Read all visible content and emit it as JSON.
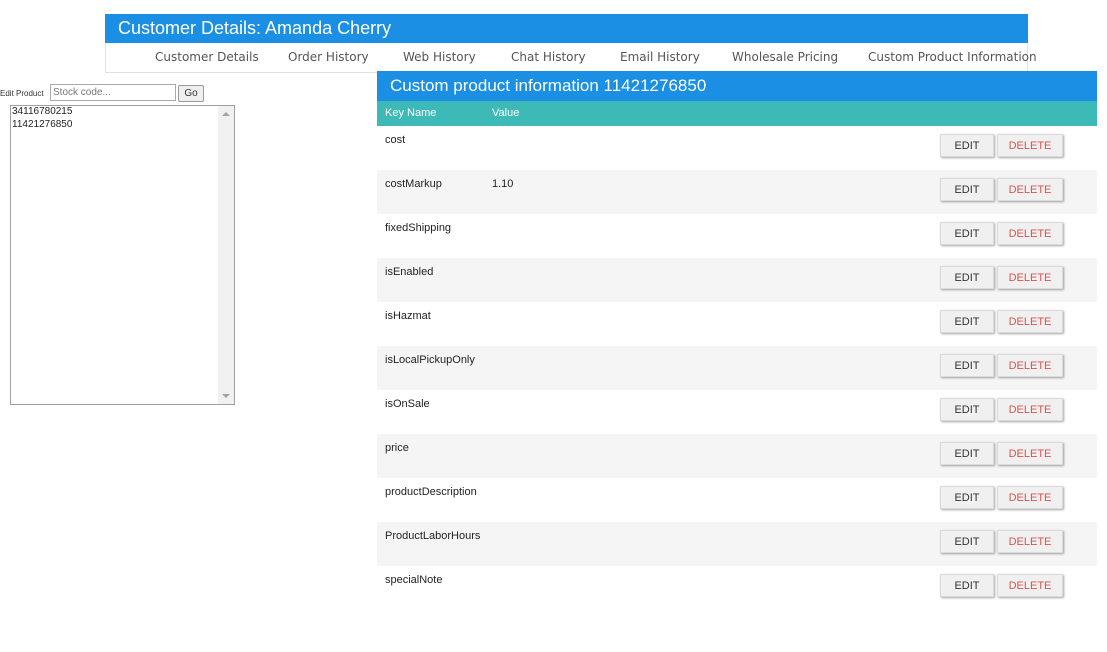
{
  "header": {
    "title": "Customer Details: Amanda Cherry"
  },
  "nav": {
    "items": [
      "Customer Details",
      "Order History",
      "Web History",
      "Chat History",
      "Email History",
      "Wholesale Pricing",
      "Custom Product Information"
    ]
  },
  "edit_product": {
    "label": "Edit Product",
    "placeholder": "Stock code...",
    "go_label": "Go",
    "list_items": [
      "34116780215",
      "11421276850"
    ]
  },
  "panel": {
    "title": "Custom product information 11421276850",
    "columns": {
      "key": "Key Name",
      "value": "Value"
    },
    "edit_label": "EDIT",
    "delete_label": "DELETE",
    "rows": [
      {
        "key": "cost",
        "value": ""
      },
      {
        "key": "costMarkup",
        "value": "1.10"
      },
      {
        "key": "fixedShipping",
        "value": ""
      },
      {
        "key": "isEnabled",
        "value": ""
      },
      {
        "key": "isHazmat",
        "value": ""
      },
      {
        "key": "isLocalPickupOnly",
        "value": ""
      },
      {
        "key": "isOnSale",
        "value": ""
      },
      {
        "key": "price",
        "value": ""
      },
      {
        "key": "productDescription",
        "value": ""
      },
      {
        "key": "ProductLaborHours",
        "value": ""
      },
      {
        "key": "specialNote",
        "value": ""
      }
    ]
  },
  "colors": {
    "header_blue": "#1a8fe3",
    "column_header_teal": "#3db9b7",
    "delete_red": "#d9534f",
    "row_alt": "#f5f5f5"
  }
}
